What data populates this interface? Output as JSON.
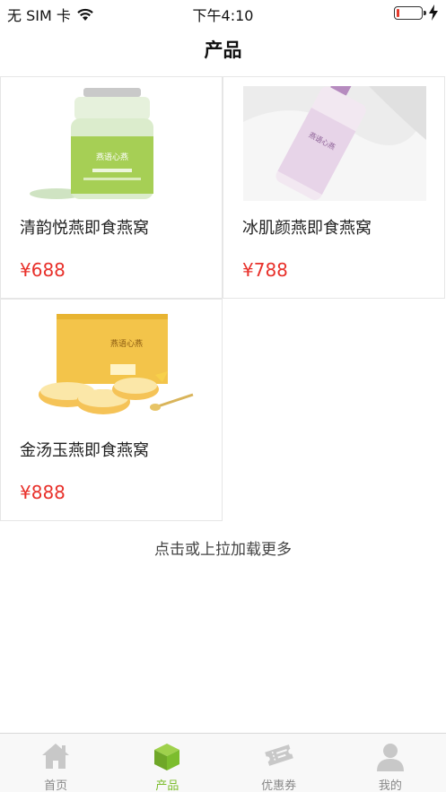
{
  "status_bar": {
    "carrier": "无 SIM 卡",
    "time": "下午4:10",
    "battery_level": 0.1
  },
  "nav": {
    "title": "产品"
  },
  "products": [
    {
      "name": "清韵悦燕即食燕窝",
      "price": "¥688",
      "image": "bottle-green-label"
    },
    {
      "name": "冰肌颜燕即食燕窝",
      "price": "¥788",
      "image": "bottle-pink-label"
    },
    {
      "name": "金汤玉燕即食燕窝",
      "price": "¥888",
      "image": "gift-box-with-cups"
    }
  ],
  "load_more": "点击或上拉加载更多",
  "tabs": [
    {
      "label": "首页",
      "icon": "home-icon",
      "active": false
    },
    {
      "label": "产品",
      "icon": "cube-icon",
      "active": true
    },
    {
      "label": "优惠券",
      "icon": "coupon-icon",
      "active": false
    },
    {
      "label": "我的",
      "icon": "user-icon",
      "active": false
    }
  ],
  "colors": {
    "accent": "#7cbd2e",
    "price": "#e8302a",
    "tab_inactive": "#888888"
  }
}
